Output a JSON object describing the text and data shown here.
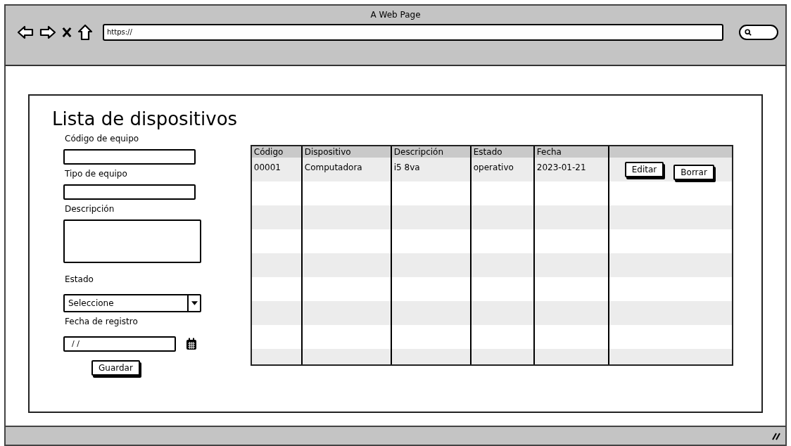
{
  "window": {
    "title": "A Web Page",
    "url": "https://"
  },
  "page": {
    "title": "Lista de dispositivos"
  },
  "form": {
    "fields": [
      {
        "kind": "text",
        "label": "Código de equipo"
      },
      {
        "kind": "text",
        "label": "Tipo de equipo"
      },
      {
        "kind": "textarea",
        "label": "Descripción"
      },
      {
        "kind": "select",
        "label": "Estado",
        "value": "Seleccione"
      },
      {
        "kind": "date",
        "label": "Fecha de registro",
        "value": "/ /"
      }
    ],
    "button": "Guardar"
  },
  "table": {
    "columns": [
      "Código",
      "Dispositivo",
      "Descripción",
      "Estado",
      "Fecha"
    ],
    "rows": [
      {
        "cells": [
          "00001",
          "Computadora",
          "i5 8va",
          "operativo",
          "2023-01-21"
        ],
        "actions": [
          "Editar",
          "Borrar"
        ]
      }
    ]
  }
}
